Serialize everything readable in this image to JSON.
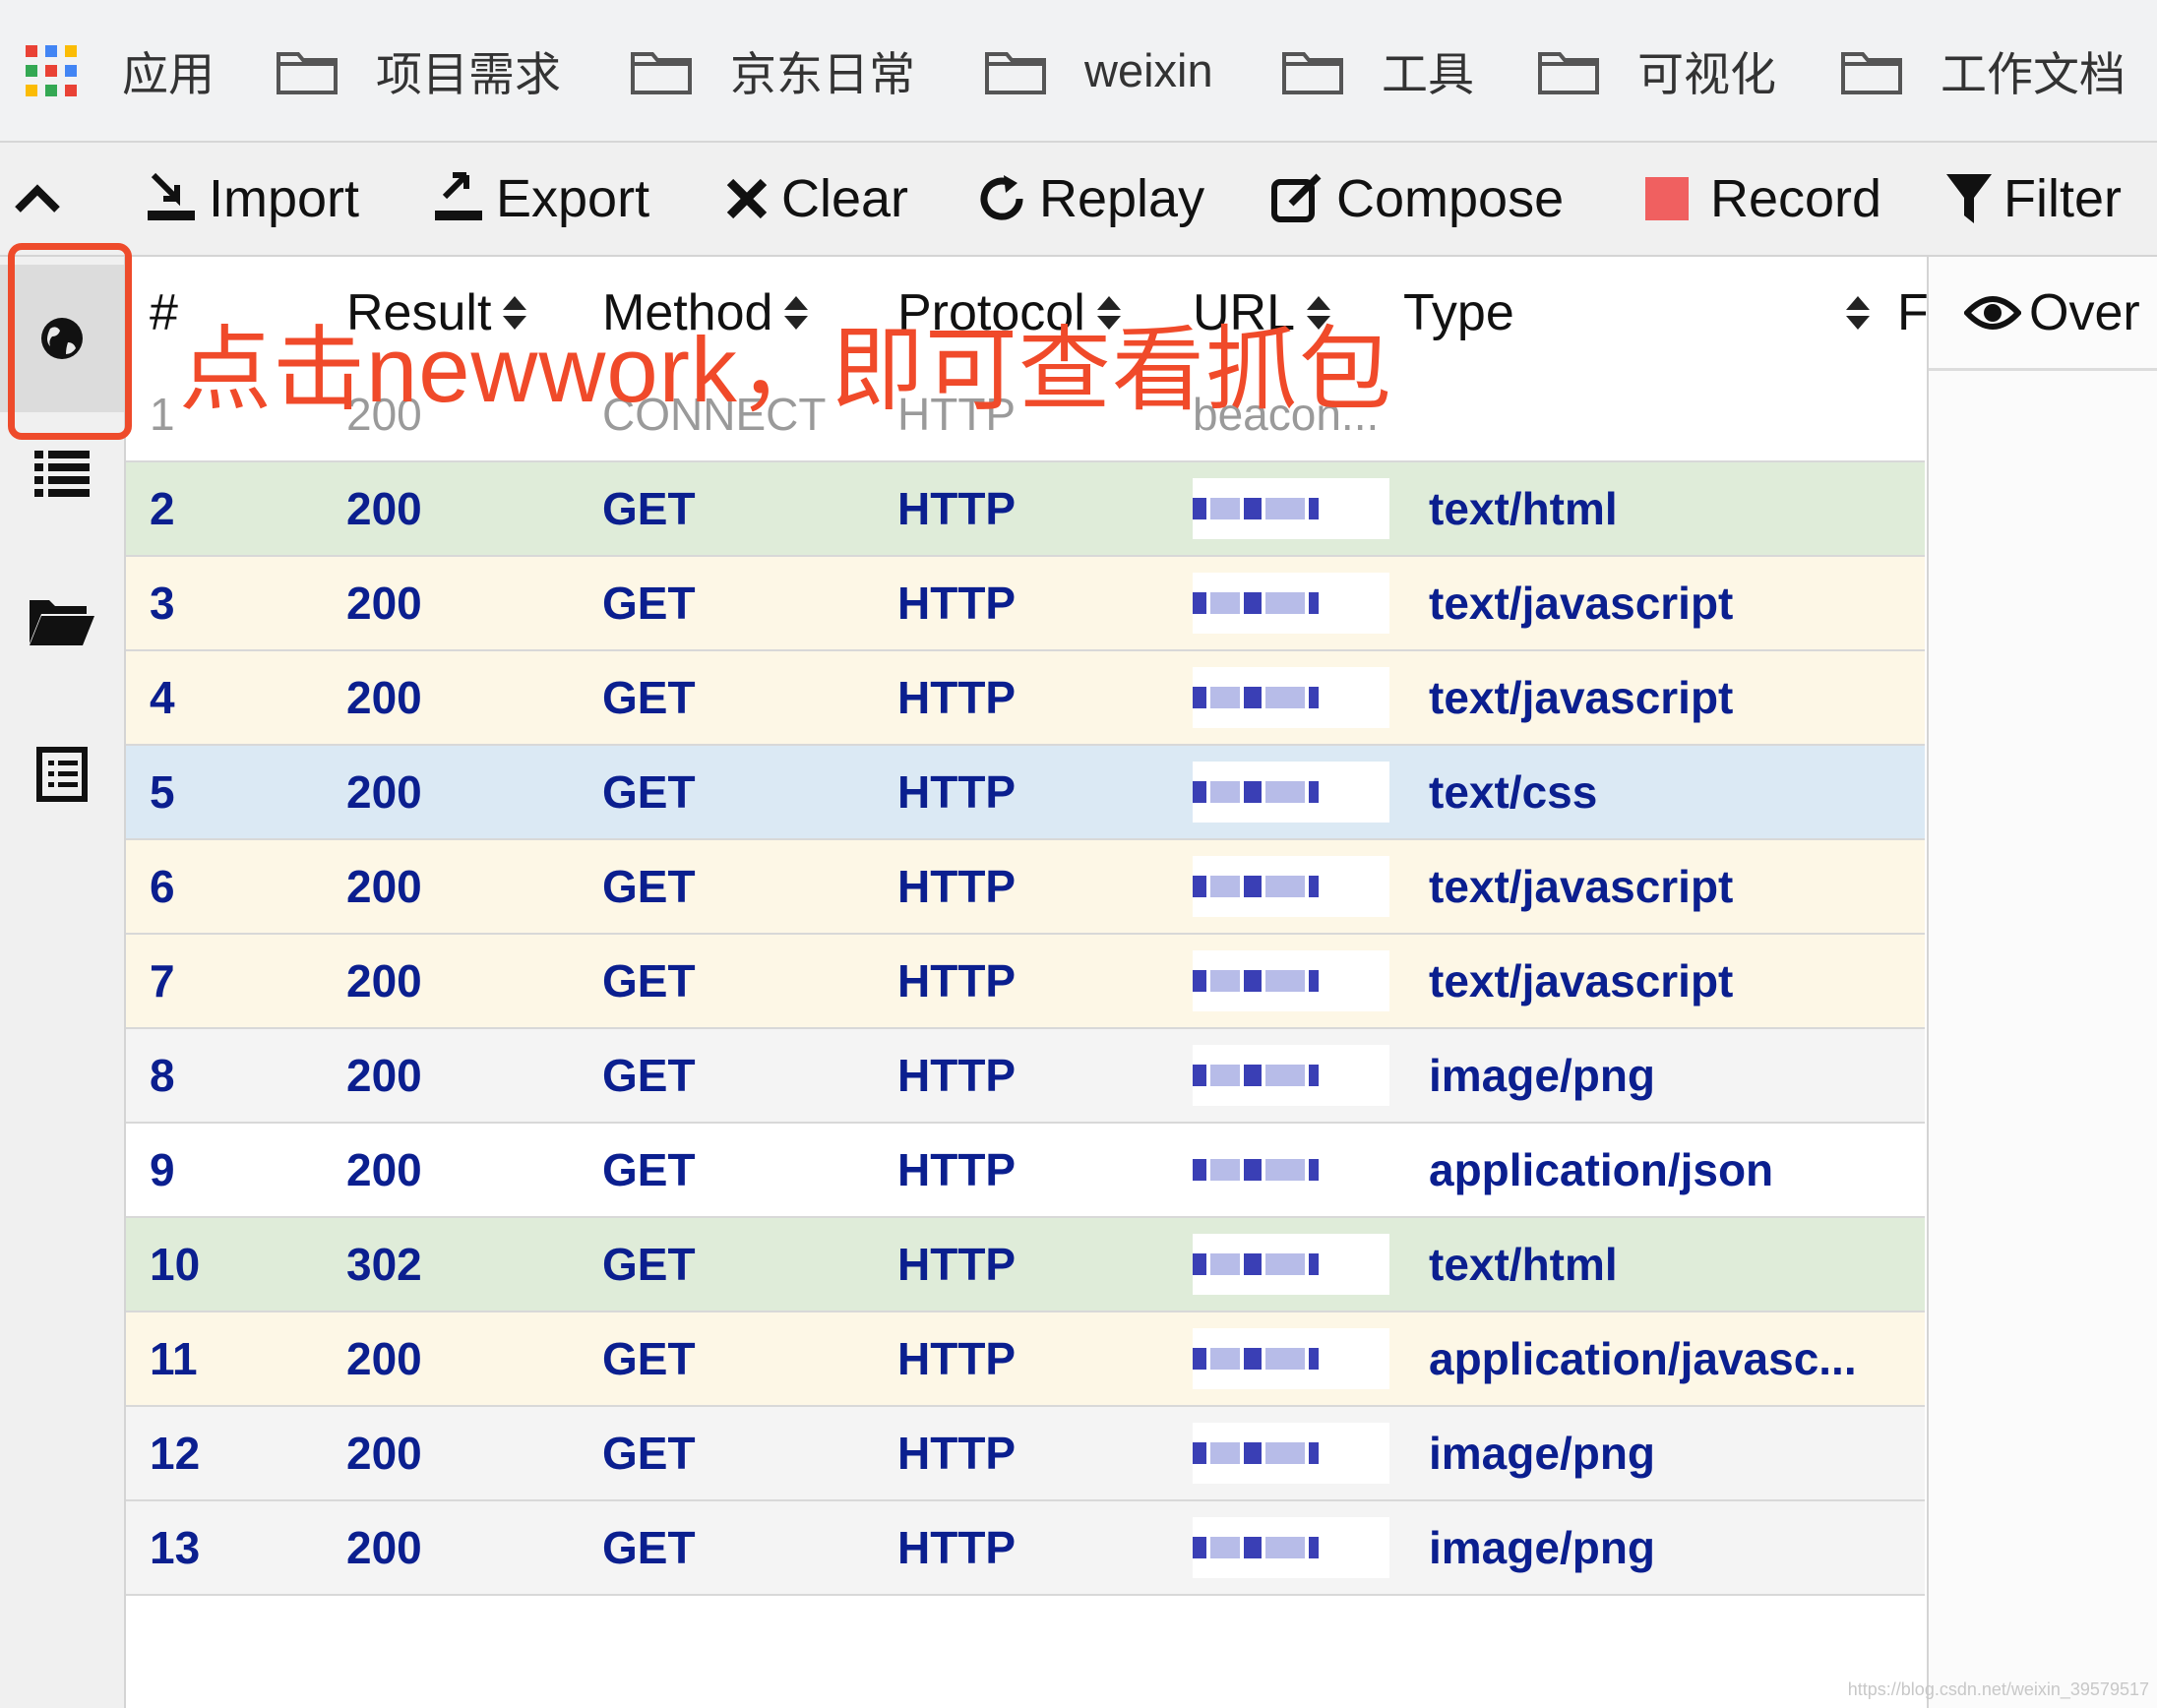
{
  "bookmarks": {
    "apps_label": "应用",
    "folders": [
      "项目需求",
      "京东日常",
      "weixin",
      "工具",
      "可视化",
      "工作文档"
    ]
  },
  "toolbar": {
    "import": "Import",
    "export": "Export",
    "clear": "Clear",
    "replay": "Replay",
    "compose": "Compose",
    "record": "Record",
    "filter": "Filter"
  },
  "annotation": "点击newwork，即可查看抓包",
  "table": {
    "headers": {
      "num": "#",
      "result": "Result",
      "method": "Method",
      "protocol": "Protocol",
      "url": "URL",
      "type": "Type",
      "extra": "F"
    },
    "rows": [
      {
        "num": "1",
        "result": "200",
        "method": "CONNECT",
        "protocol": "HTTP",
        "url": "beacon...",
        "type": "",
        "bg": "#ffffff"
      },
      {
        "num": "2",
        "result": "200",
        "method": "GET",
        "protocol": "HTTP",
        "url": "",
        "type": "text/html",
        "bg": "#dfecd9"
      },
      {
        "num": "3",
        "result": "200",
        "method": "GET",
        "protocol": "HTTP",
        "url": "",
        "type": "text/javascript",
        "bg": "#fdf7e6"
      },
      {
        "num": "4",
        "result": "200",
        "method": "GET",
        "protocol": "HTTP",
        "url": "",
        "type": "text/javascript",
        "bg": "#fdf7e6"
      },
      {
        "num": "5",
        "result": "200",
        "method": "GET",
        "protocol": "HTTP",
        "url": "",
        "type": "text/css",
        "bg": "#dbe9f4"
      },
      {
        "num": "6",
        "result": "200",
        "method": "GET",
        "protocol": "HTTP",
        "url": "",
        "type": "text/javascript",
        "bg": "#fdf7e6"
      },
      {
        "num": "7",
        "result": "200",
        "method": "GET",
        "protocol": "HTTP",
        "url": "",
        "type": "text/javascript",
        "bg": "#fdf7e6"
      },
      {
        "num": "8",
        "result": "200",
        "method": "GET",
        "protocol": "HTTP",
        "url": "",
        "type": "image/png",
        "bg": "#f4f4f4"
      },
      {
        "num": "9",
        "result": "200",
        "method": "GET",
        "protocol": "HTTP",
        "url": "",
        "type": "application/json",
        "bg": "#ffffff"
      },
      {
        "num": "10",
        "result": "302",
        "method": "GET",
        "protocol": "HTTP",
        "url": "",
        "type": "text/html",
        "bg": "#dfecd9"
      },
      {
        "num": "11",
        "result": "200",
        "method": "GET",
        "protocol": "HTTP",
        "url": "",
        "type": "application/javasc...",
        "bg": "#fdf7e6"
      },
      {
        "num": "12",
        "result": "200",
        "method": "GET",
        "protocol": "HTTP",
        "url": "",
        "type": "image/png",
        "bg": "#f4f4f4"
      },
      {
        "num": "13",
        "result": "200",
        "method": "GET",
        "protocol": "HTTP",
        "url": "",
        "type": "image/png",
        "bg": "#f4f4f4"
      }
    ]
  },
  "right_panel": {
    "overview_label": "Over"
  },
  "watermark": "https://blog.csdn.net/weixin_39579517",
  "colors": {
    "annotation": "#f04a2a",
    "record": "#f06060",
    "row_text": "#0b1f8f"
  }
}
